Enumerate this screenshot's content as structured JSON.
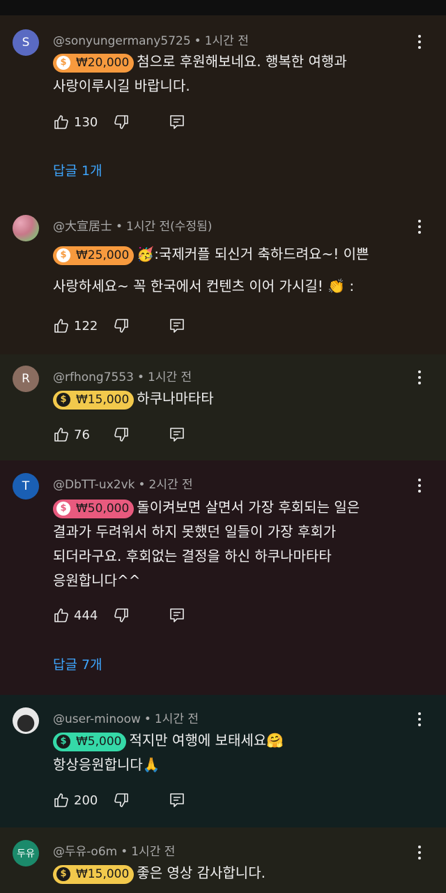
{
  "comments": [
    {
      "handle": "@sonyungermany5725",
      "time": "1시간 전",
      "avatar_letter": "S",
      "avatar_color": "#5a6ac2",
      "amount": "₩20,000",
      "pill_color": "#f79a3e",
      "lines": [
        "첨으로 후원해보네요. 행복한 여행과",
        "사랑이루시길 바랍니다."
      ],
      "likes": "130",
      "replies": "답글 1개",
      "bg": "#231c16"
    },
    {
      "handle": "@大宣居士",
      "time": "1시간 전(수정됨)",
      "avatar_letter": "",
      "avatar_color": "#c98a9a",
      "amount": "₩25,000",
      "pill_color": "#f79a3e",
      "lines": [
        ":국제커플 되신거 축하드려요~! 이쁜",
        "사랑하세요~ 꼭 한국에서 컨텐츠 이어 가시길! ",
        " :"
      ],
      "likes": "122",
      "bg": "#231c16"
    },
    {
      "handle": "@rfhong7553",
      "time": "1시간 전",
      "avatar_letter": "R",
      "avatar_color": "#8a6d60",
      "amount": "₩15,000",
      "pill_color": "#f2c94c",
      "lines": [
        "하쿠나마타타"
      ],
      "likes": "76",
      "bg": "#22221a"
    },
    {
      "handle": "@DbTT-ux2vk",
      "time": "2시간 전",
      "avatar_letter": "T",
      "avatar_color": "#1a5fb4",
      "amount": "₩50,000",
      "pill_color": "#e85a7e",
      "lines": [
        "돌이켜보면 살면서 가장 후회되는 일은",
        "결과가 두려워서 하지 못했던 일들이 가장 후회가",
        "되더라구요. 후회없는 결정을 하신 하쿠나마타타",
        "응원합니다^^"
      ],
      "likes": "444",
      "replies": "답글 7개",
      "bg": "#231619"
    },
    {
      "handle": "@user-minoow",
      "time": "1시간 전",
      "avatar_letter": "",
      "avatar_color": "#d9d9d9",
      "amount": "₩5,000",
      "pill_color": "#35d9a8",
      "lines": [
        "적지만 여행에 보태세요",
        "항상응원합니다"
      ],
      "likes": "200",
      "bg": "#122020"
    },
    {
      "handle": "@두유-o6m",
      "time": "1시간 전",
      "avatar_letter": "두유",
      "avatar_color": "#1b8a6b",
      "amount": "₩15,000",
      "pill_color": "#f2c94c",
      "lines": [
        "좋은 영상 감사합니다."
      ],
      "bg": "#22221a"
    }
  ]
}
